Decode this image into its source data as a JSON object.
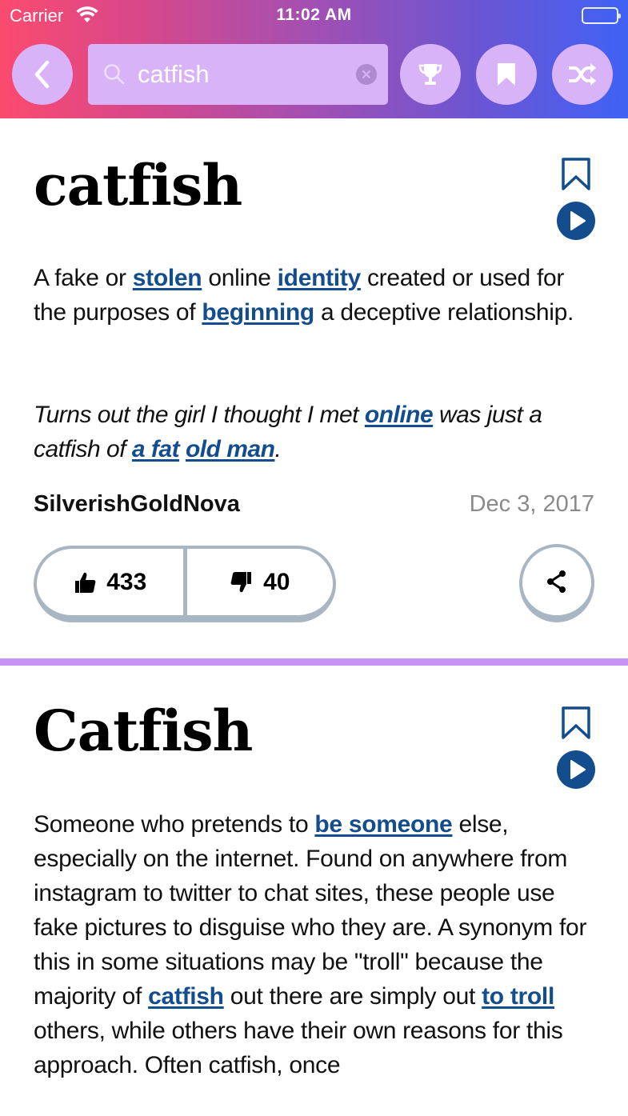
{
  "status_bar": {
    "carrier": "Carrier",
    "time": "11:02 AM",
    "wifi_icon": "wifi-icon",
    "battery_icon": "battery-icon"
  },
  "header": {
    "back_icon": "chevron-left-icon",
    "search": {
      "value": "catfish",
      "placeholder": "",
      "icon": "search-icon",
      "clear_icon": "clear-icon"
    },
    "buttons": [
      {
        "name": "trophy",
        "icon": "trophy-icon"
      },
      {
        "name": "bookmarks",
        "icon": "bookmark-icon"
      },
      {
        "name": "random",
        "icon": "shuffle-icon"
      }
    ],
    "gradient_colors": [
      "#fb4a6f",
      "#3f62f5"
    ],
    "button_color": "#d9b3f7"
  },
  "accent_color": "#134d8d",
  "divider_color": "#c794f5",
  "definitions": [
    {
      "word": "catfish",
      "meaning": {
        "t1": "A fake or ",
        "l1": "stolen",
        "t2": " online ",
        "l2": "identity",
        "t3": " created or used for the purposes of ",
        "l3": "beginning",
        "t4": " a deceptive relationship."
      },
      "example": {
        "t1": "Turns out the girl I thought I met ",
        "l1": "online",
        "t2": " was just a catfish of ",
        "l2": "a fat",
        "t3": " ",
        "l3": "old man",
        "t4": "."
      },
      "author": "SilverishGoldNova",
      "date": "Dec 3, 2017",
      "upvotes": "433",
      "downvotes": "40"
    },
    {
      "word": "Catfish",
      "meaning": {
        "t1": "Someone who pretends to ",
        "l1": "be someone",
        "t2": " else, especially on the internet. Found on anywhere from instagram to twitter to chat sites, these people use fake pictures to disguise who they are. A synonym for this in some situations may be \"troll\" because the majority of ",
        "l2": "catfish",
        "t3": " out there are simply out ",
        "l3": "to troll",
        "t4": " others, while others have their own reasons for this approach. Often catfish, once"
      }
    }
  ]
}
